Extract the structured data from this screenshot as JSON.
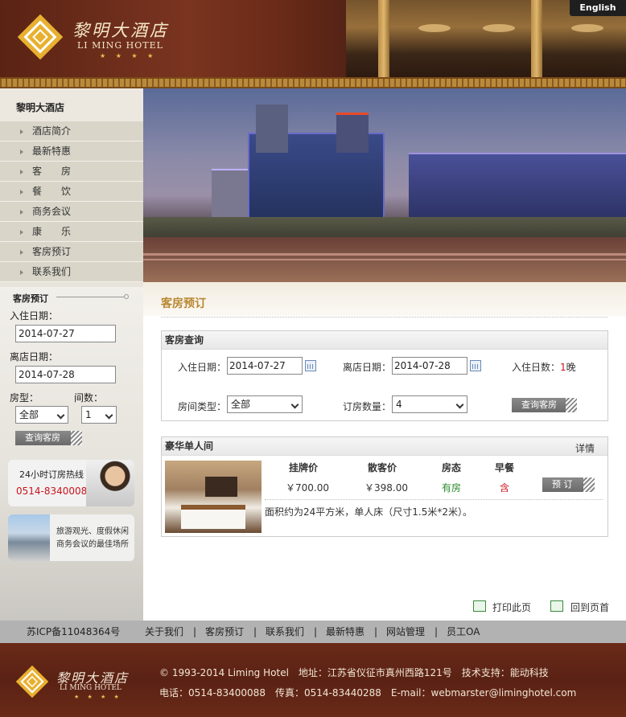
{
  "header": {
    "logo_cn": "黎明大酒店",
    "logo_en": "LI MING HOTEL",
    "logo_stars": "★ ★ ★ ★",
    "lang_button": "English"
  },
  "sidebar": {
    "title": "黎明大酒店",
    "items": [
      {
        "label": "酒店简介"
      },
      {
        "label": "最新特惠"
      },
      {
        "label": "客　　房"
      },
      {
        "label": "餐　　饮"
      },
      {
        "label": "商务会议"
      },
      {
        "label": "康　　乐"
      },
      {
        "label": "客房预订"
      },
      {
        "label": "联系我们"
      }
    ]
  },
  "booking": {
    "title": "客房预订",
    "checkin_label": "入住日期：",
    "checkin_value": "2014-07-27",
    "checkout_label": "离店日期：",
    "checkout_value": "2014-07-28",
    "room_type_label": "房型：",
    "room_type_value": "全部",
    "count_label": "间数：",
    "count_value": "1",
    "search_button": "查询客房"
  },
  "hotline": {
    "title": "24小时订房热线",
    "phone": "0514-83400088"
  },
  "promo": {
    "line1": "旅游观光、度假休闲",
    "line2": "商务会议的最佳场所"
  },
  "main": {
    "title": "客房预订",
    "query_panel": {
      "title": "客房查询",
      "checkin_label": "入住日期：",
      "checkin_value": "2014-07-27",
      "checkout_label": "离店日期：",
      "checkout_value": "2014-07-28",
      "nights_label": "入住日数：",
      "nights_value": "1",
      "nights_unit": "晚",
      "room_type_label": "房间类型：",
      "room_type_value": "全部",
      "room_count_label": "订房数量：",
      "room_count_value": "4",
      "search_button": "查询客房"
    },
    "room": {
      "name": "豪华单人间",
      "details_link": "详情",
      "headers": [
        "挂牌价",
        "散客价",
        "房态",
        "早餐"
      ],
      "list_price": "￥700.00",
      "walkin_price": "￥398.00",
      "status": "有房",
      "breakfast": "含",
      "book_button": "预 订",
      "description": "面积约为24平方米，单人床（尺寸1.5米*2米）。"
    },
    "print_link": "打印此页",
    "back_link": "回到页首"
  },
  "linkbar": {
    "icp": "苏ICP备11048364号",
    "links": [
      "关于我们",
      "客房预订",
      "联系我们",
      "最新特惠",
      "网站管理",
      "员工OA"
    ],
    "separator": "|"
  },
  "footer": {
    "logo_cn": "黎明大酒店",
    "logo_en": "LI MING HOTEL",
    "logo_stars": "★ ★ ★ ★",
    "line1": "© 1993-2014 Liming Hotel　地址：江苏省仪征市真州西路121号　技术支持：能动科技",
    "line2": "电话：0514-83400088　传真：0514-83440288　E-mail：webmarster@liminghotel.com"
  },
  "colors": {
    "brand_brown": "#6a2a18",
    "accent_gold": "#b8862e",
    "status_green": "#2a8a2a",
    "price_red": "#c8141e"
  }
}
